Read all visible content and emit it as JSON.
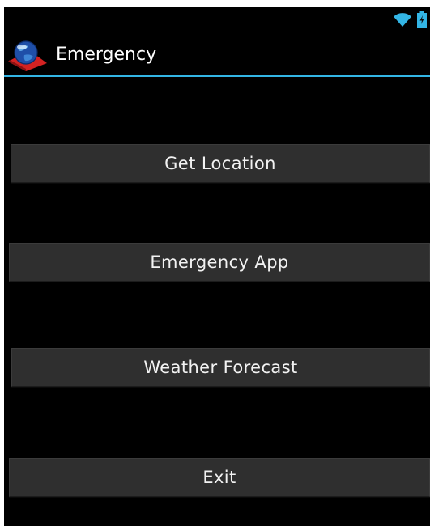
{
  "status_bar": {
    "icons": [
      "wifi-icon",
      "battery-charging-icon"
    ],
    "accent": "#33b5e5"
  },
  "action_bar": {
    "title": "Emergency",
    "icon": "globe-app-icon",
    "divider_color": "#33b5e5"
  },
  "buttons": {
    "get_location": "Get Location",
    "emergency_app": "Emergency App",
    "weather_forecast": "Weather Forecast",
    "exit": "Exit"
  },
  "colors": {
    "background": "#000000",
    "button_bg": "#2f2f2f",
    "button_text": "#f2f2f2"
  }
}
